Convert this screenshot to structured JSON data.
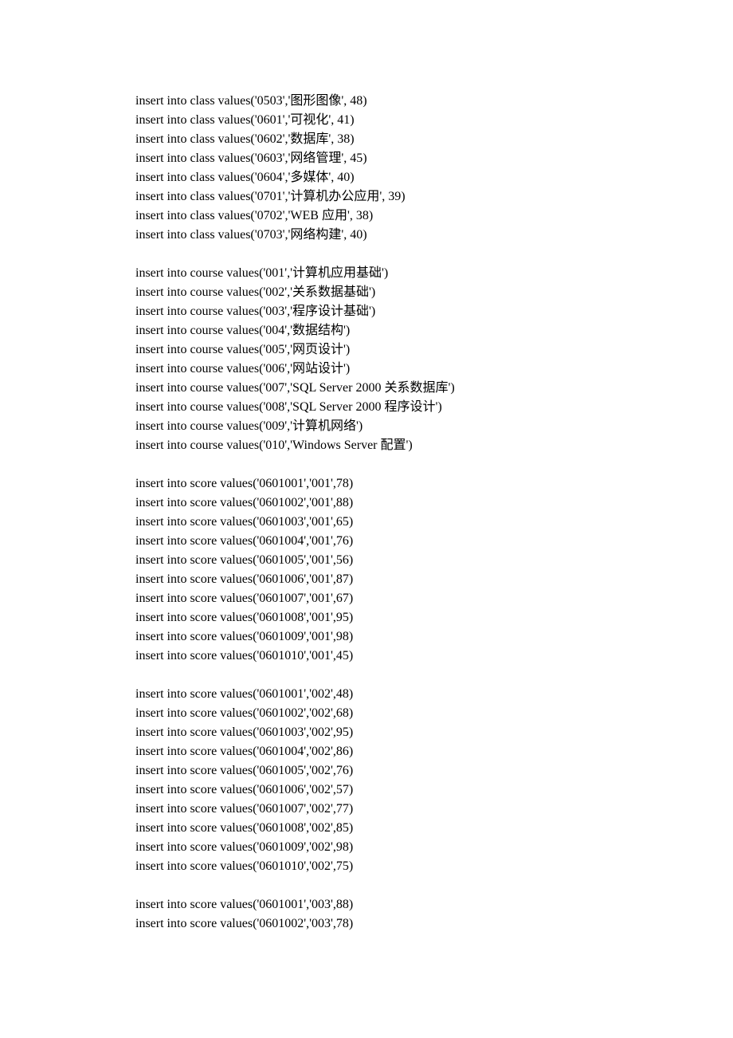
{
  "blocks": [
    {
      "lines": [
        "insert into class values('0503','图形图像', 48)",
        "insert into class values('0601','可视化', 41)",
        "insert into class values('0602','数据库', 38)",
        "insert into class values('0603','网络管理', 45)",
        "insert into class values('0604','多媒体', 40)",
        "insert into class values('0701','计算机办公应用', 39)",
        "insert into class values('0702','WEB 应用', 38)",
        "insert into class values('0703','网络构建', 40)"
      ]
    },
    {
      "lines": [
        "insert into course values('001','计算机应用基础')",
        "insert into course values('002','关系数据基础')",
        "insert into course values('003','程序设计基础')",
        "insert into course values('004','数据结构')",
        "insert into course values('005','网页设计')",
        "insert into course values('006','网站设计')",
        "insert into course values('007','SQL Server 2000 关系数据库')",
        "insert into course values('008','SQL Server 2000 程序设计')",
        "insert into course values('009','计算机网络')",
        "insert into course values('010','Windows Server  配置')"
      ]
    },
    {
      "lines": [
        "insert into score values('0601001','001',78)",
        "insert into score values('0601002','001',88)",
        "insert into score values('0601003','001',65)",
        "insert into score values('0601004','001',76)",
        "insert into score values('0601005','001',56)",
        "insert into score values('0601006','001',87)",
        "insert into score values('0601007','001',67)",
        "insert into score values('0601008','001',95)",
        "insert into score values('0601009','001',98)",
        "insert into score values('0601010','001',45)"
      ]
    },
    {
      "lines": [
        "insert into score values('0601001','002',48)",
        "insert into score values('0601002','002',68)",
        "insert into score values('0601003','002',95)",
        "insert into score values('0601004','002',86)",
        "insert into score values('0601005','002',76)",
        "insert into score values('0601006','002',57)",
        "insert into score values('0601007','002',77)",
        "insert into score values('0601008','002',85)",
        "insert into score values('0601009','002',98)",
        "insert into score values('0601010','002',75)"
      ]
    },
    {
      "lines": [
        "insert into score values('0601001','003',88)",
        "insert into score values('0601002','003',78)"
      ]
    }
  ]
}
